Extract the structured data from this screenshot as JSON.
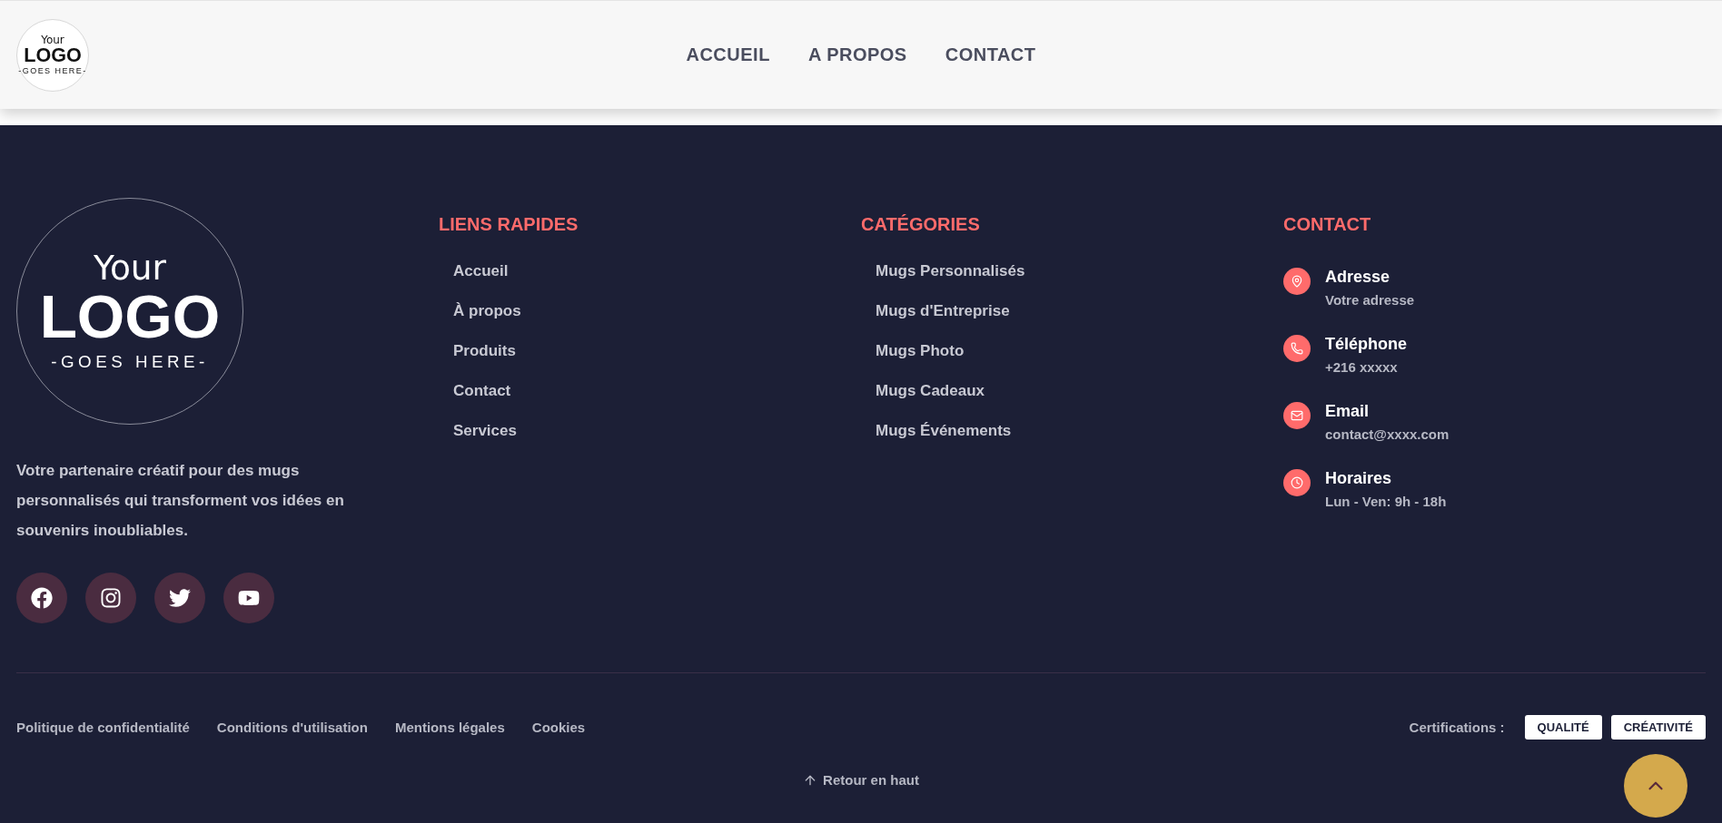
{
  "header": {
    "logo": {
      "top": "Your",
      "main": "LOGO",
      "bottom": "-GOES HERE-"
    },
    "nav": [
      {
        "label": "ACCUEIL"
      },
      {
        "label": "A PROPOS"
      },
      {
        "label": "CONTACT"
      }
    ]
  },
  "footer": {
    "logo": {
      "top": "Your",
      "main": "LOGO",
      "bottom": "-GOES HERE-"
    },
    "description": "Votre partenaire créatif pour des mugs personnalisés qui transforment vos idées en souvenirs inoubliables.",
    "social": [
      {
        "kind": "facebook"
      },
      {
        "kind": "instagram"
      },
      {
        "kind": "twitter"
      },
      {
        "kind": "youtube"
      }
    ],
    "columns": [
      {
        "title": "LIENS RAPIDES",
        "links": [
          "Accueil",
          "À propos",
          "Produits",
          "Contact",
          "Services"
        ]
      },
      {
        "title": "CATÉGORIES",
        "links": [
          "Mugs Personnalisés",
          "Mugs d'Entreprise",
          "Mugs Photo",
          "Mugs Cadeaux",
          "Mugs Événements"
        ]
      }
    ],
    "contact": {
      "title": "CONTACT",
      "items": [
        {
          "kind": "address",
          "label": "Adresse",
          "value": "Votre adresse"
        },
        {
          "kind": "phone",
          "label": "Téléphone",
          "value": "+216 xxxxx"
        },
        {
          "kind": "email",
          "label": "Email",
          "value": "contact@xxxx.com"
        },
        {
          "kind": "hours",
          "label": "Horaires",
          "value": "Lun - Ven: 9h - 18h"
        }
      ]
    },
    "legal_links": [
      "Politique de confidentialité",
      "Conditions d'utilisation",
      "Mentions légales",
      "Cookies"
    ],
    "certifications": {
      "label": "Certifications :",
      "badges": [
        "QUALITÉ",
        "CRÉATIVITÉ"
      ]
    },
    "back_to_top": "Retour en haut"
  }
}
